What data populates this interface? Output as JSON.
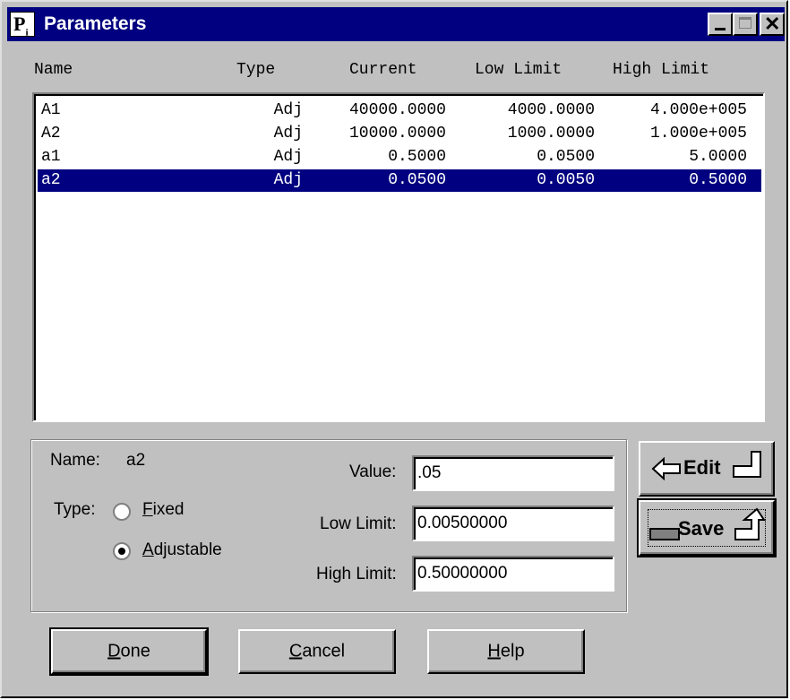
{
  "window": {
    "title": "Parameters",
    "icon_letters": "P",
    "icon_sub": "i"
  },
  "columns": {
    "name": "Name",
    "type": "Type",
    "current": "Current",
    "low": "Low Limit",
    "high": "High Limit"
  },
  "rows": [
    {
      "name": "A1",
      "type": "Adj",
      "current": "40000.0000",
      "low": "4000.0000",
      "high": "4.000e+005",
      "selected": false
    },
    {
      "name": "A2",
      "type": "Adj",
      "current": "10000.0000",
      "low": "1000.0000",
      "high": "1.000e+005",
      "selected": false
    },
    {
      "name": "a1",
      "type": "Adj",
      "current": "0.5000",
      "low": "0.0500",
      "high": "5.0000",
      "selected": false
    },
    {
      "name": "a2",
      "type": "Adj",
      "current": "0.0500",
      "low": "0.0050",
      "high": "0.5000",
      "selected": true
    }
  ],
  "detail": {
    "name_label": "Name:",
    "name_value": "a2",
    "type_label": "Type:",
    "fixed_label_u": "F",
    "fixed_label_rest": "ixed",
    "adjustable_label_u": "A",
    "adjustable_label_rest": "djustable",
    "selected_type": "Adjustable",
    "value_label": "Value:",
    "value": ".05",
    "low_label": "Low Limit:",
    "low_value": "0.00500000",
    "high_label": "High Limit:",
    "high_value": "0.50000000"
  },
  "side_buttons": {
    "edit": "Edit",
    "save": "Save"
  },
  "buttons": {
    "done_u": "D",
    "done_rest": "one",
    "cancel_u": "C",
    "cancel_rest": "ancel",
    "help_u": "H",
    "help_rest": "elp"
  }
}
